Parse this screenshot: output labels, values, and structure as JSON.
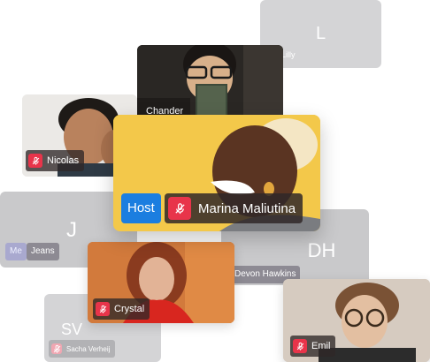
{
  "participants": {
    "lilly": {
      "initial": "L",
      "name": "Lilly"
    },
    "chander": {
      "name": "Chander"
    },
    "nicolas": {
      "name": "Nicolas"
    },
    "marina": {
      "role": "Host",
      "name": "Marina Maliutina"
    },
    "me": {
      "initial": "J",
      "me_tag": "Me",
      "name": "Jeans"
    },
    "devon": {
      "initials": "DH",
      "name": "Devon Hawkins"
    },
    "crystal": {
      "name": "Crystal"
    },
    "sacha": {
      "initials": "SV",
      "name": "Sacha Verheij"
    },
    "emil": {
      "name": "Emil"
    }
  },
  "icons": {
    "muted_microphone": "mic-off-icon"
  },
  "colors": {
    "host_badge": "#1b7ee0",
    "mute_badge": "#e8344a",
    "avatar_tile": "#c9c9cb",
    "host_card_background": "#f2c94c"
  }
}
